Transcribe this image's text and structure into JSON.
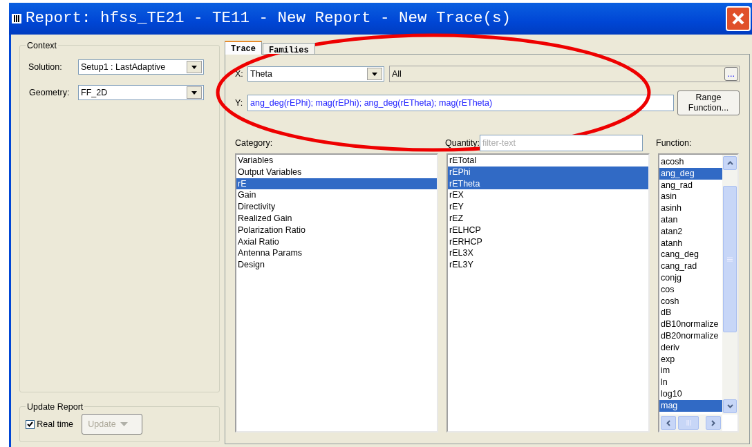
{
  "window": {
    "title": "Report: hfss_TE21 - TE11 - New Report - New Trace(s)"
  },
  "context": {
    "title": "Context",
    "solution": {
      "label": "Solution:",
      "value": "Setup1 : LastAdaptive"
    },
    "geometry": {
      "label": "Geometry:",
      "value": "FF_2D"
    }
  },
  "update_report": {
    "title": "Update Report",
    "real_time": {
      "label": "Real time",
      "checked": true
    },
    "update_button": {
      "label": "Update",
      "disabled": true
    }
  },
  "tabs": [
    {
      "label": "Trace",
      "selected": true
    },
    {
      "label": "Families",
      "selected": false
    }
  ],
  "x": {
    "label": "X:",
    "value": "Theta",
    "range": "All",
    "more_button": "..."
  },
  "y": {
    "label": "Y:",
    "value": "ang_deg(rEPhi); mag(rEPhi); ang_deg(rETheta); mag(rETheta)"
  },
  "range_button": {
    "lines": [
      "Range",
      "Function..."
    ]
  },
  "category": {
    "label": "Category:",
    "items": [
      {
        "label": "Variables",
        "selected": false
      },
      {
        "label": "Output Variables",
        "selected": false
      },
      {
        "label": "rE",
        "selected": true
      },
      {
        "label": "Gain",
        "selected": false
      },
      {
        "label": "Directivity",
        "selected": false
      },
      {
        "label": "Realized Gain",
        "selected": false
      },
      {
        "label": "Polarization Ratio",
        "selected": false
      },
      {
        "label": "Axial Ratio",
        "selected": false
      },
      {
        "label": "Antenna Params",
        "selected": false
      },
      {
        "label": "Design",
        "selected": false
      }
    ]
  },
  "quantity": {
    "label": "Quantity:",
    "filter_placeholder": "filter-text",
    "items": [
      {
        "label": "rETotal",
        "selected": false
      },
      {
        "label": "rEPhi",
        "selected": true
      },
      {
        "label": "rETheta",
        "selected": true
      },
      {
        "label": "rEX",
        "selected": false
      },
      {
        "label": "rEY",
        "selected": false
      },
      {
        "label": "rEZ",
        "selected": false
      },
      {
        "label": "rELHCP",
        "selected": false
      },
      {
        "label": "rERHCP",
        "selected": false
      },
      {
        "label": "rEL3X",
        "selected": false
      },
      {
        "label": "rEL3Y",
        "selected": false
      }
    ]
  },
  "function": {
    "label": "Function:",
    "items": [
      {
        "label": "acosh",
        "selected": false
      },
      {
        "label": "ang_deg",
        "selected": true
      },
      {
        "label": "ang_rad",
        "selected": false
      },
      {
        "label": "asin",
        "selected": false
      },
      {
        "label": "asinh",
        "selected": false
      },
      {
        "label": "atan",
        "selected": false
      },
      {
        "label": "atan2",
        "selected": false
      },
      {
        "label": "atanh",
        "selected": false
      },
      {
        "label": "cang_deg",
        "selected": false
      },
      {
        "label": "cang_rad",
        "selected": false
      },
      {
        "label": "conjg",
        "selected": false
      },
      {
        "label": "cos",
        "selected": false
      },
      {
        "label": "cosh",
        "selected": false
      },
      {
        "label": "dB",
        "selected": false
      },
      {
        "label": "dB10normalize",
        "selected": false
      },
      {
        "label": "dB20normalize",
        "selected": false
      },
      {
        "label": "deriv",
        "selected": false
      },
      {
        "label": "exp",
        "selected": false
      },
      {
        "label": "im",
        "selected": false
      },
      {
        "label": "ln",
        "selected": false
      },
      {
        "label": "log10",
        "selected": false
      },
      {
        "label": "mag",
        "selected": true
      }
    ]
  }
}
